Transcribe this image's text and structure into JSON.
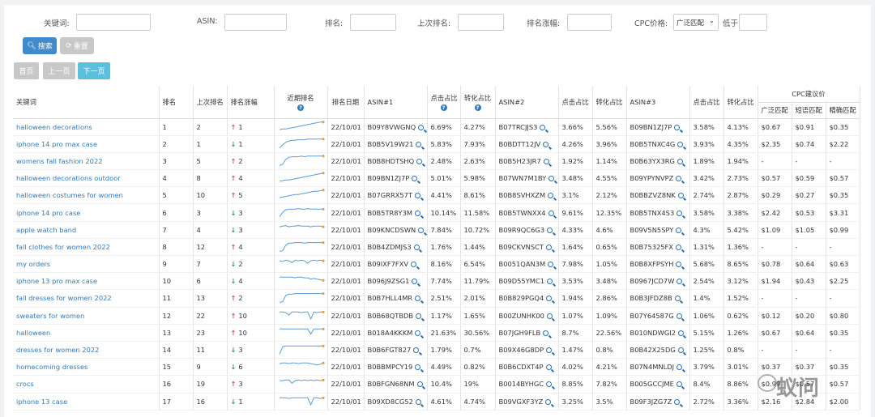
{
  "filters": {
    "keyword_label": "关键词:",
    "asin_label": "ASIN:",
    "rank_label": "排名:",
    "last_rank_label": "上次排名:",
    "rank_change_label": "排名涨幅:",
    "cpc_label": "CPC价格:",
    "cpc_select": "广泛匹配",
    "cpc_lt_label": "低于"
  },
  "buttons": {
    "search": "搜索",
    "reset": "重置"
  },
  "pager": {
    "first": "首页",
    "prev": "上一页",
    "next": "下一页"
  },
  "headers": {
    "keyword": "关键词",
    "rank": "排名",
    "last_rank": "上次排名",
    "change": "排名涨幅",
    "trend": "近期排名",
    "date": "排名日期",
    "asin1": "ASIN#1",
    "click_share": "点击占比",
    "conv_share": "转化占比",
    "asin2": "ASIN#2",
    "asin3": "ASIN#3",
    "cpc_group": "CPC建议价",
    "cpc_broad": "广泛匹配",
    "cpc_phrase": "短语匹配",
    "cpc_exact": "精确匹配"
  },
  "rows": [
    {
      "kw": "halloween decorations",
      "rank": "1",
      "last": "2",
      "dir": "up",
      "chg": "1",
      "date": "22/10/01",
      "a1": "B09Y8VWGNQ",
      "c1": "6.69%",
      "v1": "4.27%",
      "a2": "B07TRCJJS3",
      "c2": "3.66%",
      "v2": "5.56%",
      "a3": "B09BN1ZJ7P",
      "c3": "3.58%",
      "v3": "4.13%",
      "p1": "$0.67",
      "p2": "$0.91",
      "p3": "$0.35",
      "spark": [
        5,
        6,
        6,
        7,
        8,
        9,
        10,
        11,
        12,
        13,
        14,
        15,
        16,
        17,
        17
      ]
    },
    {
      "kw": "iphone 14 pro max case",
      "rank": "2",
      "last": "1",
      "dir": "dn",
      "chg": "1",
      "date": "22/10/01",
      "a1": "B0B5V19W21",
      "c1": "5.83%",
      "v1": "7.93%",
      "a2": "B0BDTT12JV",
      "c2": "4.26%",
      "v2": "3.96%",
      "a3": "B0B5TNXC4G",
      "c3": "3.93%",
      "v3": "4.35%",
      "p1": "$2.35",
      "p2": "$0.74",
      "p3": "$2.22",
      "spark": [
        3,
        8,
        12,
        14,
        15,
        15,
        16,
        16,
        16,
        17,
        17,
        17,
        17,
        17,
        17
      ]
    },
    {
      "kw": "womens fall fashion 2022",
      "rank": "3",
      "last": "5",
      "dir": "up",
      "chg": "2",
      "date": "22/10/01",
      "a1": "B0B8HDTSHQ",
      "c1": "2.48%",
      "v1": "2.63%",
      "a2": "B0B5H23JR7",
      "c2": "1.92%",
      "v2": "1.14%",
      "a3": "B0B63YX3RG",
      "c3": "1.89%",
      "v3": "1.94%",
      "p1": "-",
      "p2": "-",
      "p3": "-",
      "spark": [
        2,
        4,
        12,
        15,
        16,
        16,
        16,
        17,
        16,
        17,
        17,
        17,
        17,
        17,
        17
      ]
    },
    {
      "kw": "halloween decorations outdoor",
      "rank": "4",
      "last": "8",
      "dir": "up",
      "chg": "4",
      "date": "22/10/01",
      "a1": "B09BN1ZJ7P",
      "c1": "5.01%",
      "v1": "5.98%",
      "a2": "B07WN7M1BY",
      "c2": "3.48%",
      "v2": "4.55%",
      "a3": "B09YPYNVPZ",
      "c3": "3.42%",
      "v3": "2.73%",
      "p1": "$0.57",
      "p2": "$0.59",
      "p3": "$0.57",
      "spark": [
        4,
        5,
        6,
        6,
        7,
        8,
        9,
        10,
        11,
        12,
        13,
        14,
        15,
        16,
        17
      ]
    },
    {
      "kw": "halloween costumes for women",
      "rank": "5",
      "last": "10",
      "dir": "up",
      "chg": "5",
      "date": "22/10/01",
      "a1": "B07GRRX57T",
      "c1": "4.41%",
      "v1": "8.61%",
      "a2": "B0B8SVHXZM",
      "c2": "3.1%",
      "v2": "2.12%",
      "a3": "B0BBZVZ8NK",
      "c3": "2.74%",
      "v3": "2.87%",
      "p1": "$0.29",
      "p2": "$0.27",
      "p3": "$0.35",
      "spark": [
        5,
        6,
        7,
        8,
        9,
        10,
        10,
        11,
        12,
        13,
        14,
        15,
        15,
        16,
        17
      ]
    },
    {
      "kw": "iphone 14 pro case",
      "rank": "6",
      "last": "3",
      "dir": "dn",
      "chg": "3",
      "date": "22/10/01",
      "a1": "B0B5TR8Y3M",
      "c1": "10.14%",
      "v1": "11.58%",
      "a2": "B0B5TWNXX4",
      "c2": "9.61%",
      "v2": "12.35%",
      "a3": "B0B5TNX4S3",
      "c3": "3.58%",
      "v3": "3.38%",
      "p1": "$2.42",
      "p2": "$0.53",
      "p3": "$3.31",
      "spark": [
        3,
        10,
        14,
        15,
        15,
        15,
        16,
        15,
        15,
        16,
        15,
        15,
        15,
        15,
        15
      ]
    },
    {
      "kw": "apple watch band",
      "rank": "7",
      "last": "4",
      "dir": "dn",
      "chg": "3",
      "date": "22/10/01",
      "a1": "B09KNCDSWN",
      "c1": "7.84%",
      "v1": "10.72%",
      "a2": "B09R9QC6G3",
      "c2": "4.33%",
      "v2": "4.6%",
      "a3": "B09V5N5SPY",
      "c3": "4.3%",
      "v3": "5.42%",
      "p1": "$1.09",
      "p2": "$1.05",
      "p3": "$0.99",
      "spark": [
        14,
        15,
        16,
        14,
        15,
        15,
        16,
        15,
        15,
        15,
        14,
        15,
        15,
        15,
        14
      ]
    },
    {
      "kw": "fall clothes for women 2022",
      "rank": "8",
      "last": "12",
      "dir": "up",
      "chg": "4",
      "date": "22/10/01",
      "a1": "B0B4ZDMJS3",
      "c1": "1.76%",
      "v1": "1.44%",
      "a2": "B09CKVNSCT",
      "c2": "1.64%",
      "v2": "0.65%",
      "a3": "B0B75325FX",
      "c3": "1.31%",
      "v3": "1.36%",
      "p1": "-",
      "p2": "-",
      "p3": "-",
      "spark": [
        2,
        3,
        12,
        15,
        15,
        16,
        16,
        16,
        15,
        16,
        16,
        16,
        16,
        16,
        16
      ]
    },
    {
      "kw": "my orders",
      "rank": "9",
      "last": "7",
      "dir": "dn",
      "chg": "2",
      "date": "22/10/01",
      "a1": "B09IXF7FXV",
      "c1": "8.16%",
      "v1": "6.54%",
      "a2": "B0051QAN3M",
      "c2": "7.98%",
      "v2": "1.05%",
      "a3": "B0B8XFPSYH",
      "c3": "5.68%",
      "v3": "8.65%",
      "p1": "$0.78",
      "p2": "$0.64",
      "p3": "$0.63",
      "spark": [
        14,
        13,
        15,
        14,
        11,
        15,
        14,
        15,
        14,
        10,
        14,
        15,
        14,
        15,
        14
      ]
    },
    {
      "kw": "iphone 13 pro max case",
      "rank": "10",
      "last": "6",
      "dir": "dn",
      "chg": "4",
      "date": "22/10/01",
      "a1": "B096J9ZSG1",
      "c1": "7.74%",
      "v1": "11.79%",
      "a2": "B09D55YMC1",
      "c2": "3.53%",
      "v2": "3.48%",
      "a3": "B0967JCD7W",
      "c3": "2.54%",
      "v3": "3.12%",
      "p1": "$1.94",
      "p2": "$0.43",
      "p3": "$2.25",
      "spark": [
        15,
        15,
        15,
        15,
        15,
        14,
        15,
        15,
        14,
        14,
        12,
        13,
        12,
        11,
        10
      ]
    },
    {
      "kw": "fall dresses for women 2022",
      "rank": "11",
      "last": "13",
      "dir": "up",
      "chg": "2",
      "date": "22/10/01",
      "a1": "B0B7HLL4MR",
      "c1": "2.51%",
      "v1": "2.01%",
      "a2": "B0B829PGQ4",
      "c2": "1.94%",
      "v2": "2.86%",
      "a3": "B0B3JFDZ8B",
      "c3": "1.4%",
      "v3": "1.52%",
      "p1": "-",
      "p2": "-",
      "p3": "-",
      "spark": [
        2,
        3,
        13,
        15,
        15,
        16,
        16,
        16,
        16,
        16,
        16,
        16,
        16,
        16,
        16
      ]
    },
    {
      "kw": "sweaters for women",
      "rank": "12",
      "last": "22",
      "dir": "up",
      "chg": "10",
      "date": "22/10/01",
      "a1": "B0B68QTBDB",
      "c1": "1.17%",
      "v1": "1.65%",
      "a2": "B00ZUNHK00",
      "c2": "1.07%",
      "v2": "1.09%",
      "a3": "B07Y64587G",
      "c3": "1.06%",
      "v3": "0.62%",
      "p1": "$0.12",
      "p2": "$0.20",
      "p3": "$0.80",
      "spark": [
        15,
        15,
        14,
        10,
        15,
        15,
        15,
        14,
        15,
        15,
        4,
        15,
        14,
        15,
        15
      ]
    },
    {
      "kw": "halloween",
      "rank": "13",
      "last": "23",
      "dir": "up",
      "chg": "10",
      "date": "22/10/01",
      "a1": "B018A4KKKM",
      "c1": "21.63%",
      "v1": "30.56%",
      "a2": "B07JGH9FLB",
      "c2": "8.7%",
      "v2": "22.56%",
      "a3": "B010NDWGI2",
      "c3": "5.15%",
      "v3": "1.26%",
      "p1": "$0.67",
      "p2": "$0.64",
      "p3": "$0.35",
      "spark": [
        15,
        15,
        15,
        15,
        15,
        15,
        15,
        15,
        15,
        15,
        7,
        15,
        15,
        15,
        15
      ]
    },
    {
      "kw": "dresses for women 2022",
      "rank": "14",
      "last": "11",
      "dir": "dn",
      "chg": "3",
      "date": "22/10/01",
      "a1": "B0B6FGT827",
      "c1": "1.79%",
      "v1": "0.7%",
      "a2": "B09X46G8DP",
      "c2": "1.47%",
      "v2": "0.8%",
      "a3": "B0B42X25DG",
      "c3": "1.25%",
      "v3": "0.8%",
      "p1": "-",
      "p2": "-",
      "p3": "-",
      "spark": [
        2,
        14,
        15,
        15,
        15,
        15,
        15,
        15,
        15,
        15,
        15,
        15,
        15,
        15,
        15
      ]
    },
    {
      "kw": "homecoming dresses",
      "rank": "15",
      "last": "9",
      "dir": "dn",
      "chg": "6",
      "date": "22/10/01",
      "a1": "B0BBMPCY19",
      "c1": "4.49%",
      "v1": "0.82%",
      "a2": "B0B6CDXT4P",
      "c2": "4.02%",
      "v2": "4.21%",
      "a3": "B07N4MNLDJ",
      "c3": "3.79%",
      "v3": "3.01%",
      "p1": "$0.37",
      "p2": "$0.37",
      "p3": "$0.35",
      "spark": [
        14,
        15,
        15,
        14,
        15,
        15,
        14,
        15,
        15,
        15,
        14,
        13,
        12,
        13,
        15
      ]
    },
    {
      "kw": "crocs",
      "rank": "16",
      "last": "19",
      "dir": "up",
      "chg": "3",
      "date": "22/10/01",
      "a1": "B0BFGN68NM",
      "c1": "10.4%",
      "v1": "19%",
      "a2": "B0014BYHGC",
      "c2": "8.85%",
      "v2": "7.82%",
      "a3": "B005GCCJME",
      "c3": "8.4%",
      "v3": "8.86%",
      "p1": "$0.99",
      "p2": "$0.57",
      "p3": "$0.57",
      "spark": [
        14,
        14,
        15,
        15,
        10,
        14,
        15,
        14,
        15,
        14,
        15,
        14,
        15,
        14,
        15
      ]
    },
    {
      "kw": "iphone 13 case",
      "rank": "17",
      "last": "16",
      "dir": "dn",
      "chg": "1",
      "date": "22/10/01",
      "a1": "B09XD8CG52",
      "c1": "4.61%",
      "v1": "4.74%",
      "a2": "B09VGXF3YZ",
      "c2": "3.25%",
      "v2": "3.5%",
      "a3": "B09F3JZG7Z",
      "c3": "2.72%",
      "v3": "3.36%",
      "p1": "$2.16",
      "p2": "$2.84",
      "p3": "$2.00",
      "spark": [
        15,
        15,
        15,
        14,
        15,
        15,
        15,
        15,
        15,
        15,
        4,
        15,
        15,
        14,
        15
      ]
    }
  ],
  "watermark": "蚁问"
}
